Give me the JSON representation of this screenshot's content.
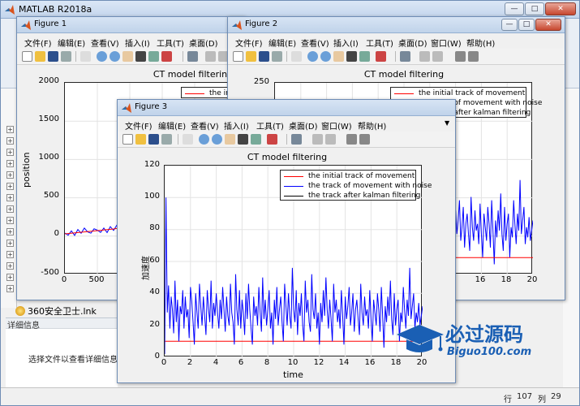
{
  "app": {
    "title": "MATLAB R2018a",
    "window_buttons": [
      "—",
      "□",
      "✕"
    ],
    "file_item": "360安全卫士.lnk",
    "details_header": "详细信息",
    "details_text": "选择文件以查看详细信息",
    "status": {
      "row_label": "行",
      "row": "107",
      "col_label": "列",
      "col": "29"
    }
  },
  "menu": [
    "文件(F)",
    "编辑(E)",
    "查看(V)",
    "插入(I)",
    "工具(T)",
    "桌面(D)",
    "窗口(W)",
    "帮助(H)"
  ],
  "figure1": {
    "title": "Figure 1",
    "plot_title": "CT model filtering",
    "ylabel": "position",
    "yticks": [
      "2000",
      "1500",
      "1000",
      "500",
      "0",
      "-500"
    ],
    "xticks": [
      "0",
      "500"
    ],
    "legend_partial": "the ini"
  },
  "figure2": {
    "title": "Figure 2",
    "plot_title": "CT model filtering",
    "yticks": [
      "250"
    ],
    "xticks": [
      "16",
      "18",
      "20"
    ],
    "legend": [
      "the initial track of movement",
      "the track of movement with noise",
      "the track after kalman filtering"
    ]
  },
  "figure3": {
    "title": "Figure 3",
    "plot_title": "CT model filtering",
    "xlabel": "time",
    "ylabel": "加速度",
    "yticks": [
      "120",
      "100",
      "80",
      "60",
      "40",
      "20",
      "0"
    ],
    "xticks": [
      "0",
      "2",
      "4",
      "6",
      "8",
      "10",
      "12",
      "14",
      "16",
      "18",
      "20"
    ],
    "legend": [
      "the initial track of movement",
      "the track of movement with noise",
      "the track after kalman filtering"
    ],
    "colors": {
      "initial": "#ff0000",
      "noise": "#0000ff",
      "kalman": "#000000"
    }
  },
  "chart_data": [
    {
      "type": "line",
      "title": "CT model filtering",
      "xlabel": "time",
      "ylabel": "加速度",
      "xlim": [
        0,
        20
      ],
      "ylim": [
        0,
        120
      ],
      "grid": true,
      "legend_position": "top-right",
      "series": [
        {
          "name": "the initial track of movement",
          "color": "#ff0000",
          "x": [
            0,
            20
          ],
          "values": [
            10,
            10
          ]
        },
        {
          "name": "the track of movement with noise",
          "color": "#0000ff",
          "x": [
            0,
            0.1,
            0.2,
            0.3,
            0.4,
            0.5,
            0.6,
            0.7,
            0.8,
            0.9,
            1.0,
            1.1,
            1.2,
            1.3,
            1.4,
            1.5,
            1.6,
            1.7,
            1.8,
            1.9,
            2.0,
            2.1,
            2.2,
            2.3,
            2.4,
            2.5,
            2.6,
            2.7,
            2.8,
            2.9,
            3.0,
            3.1,
            3.2,
            3.3,
            3.4,
            3.5,
            3.6,
            3.7,
            3.8,
            3.9,
            4.0,
            4.1,
            4.2,
            4.3,
            4.4,
            4.5,
            4.6,
            4.7,
            4.8,
            4.9,
            5.0,
            5.1,
            5.2,
            5.3,
            5.4,
            5.5,
            5.6,
            5.7,
            5.8,
            5.9,
            6.0,
            6.1,
            6.2,
            6.3,
            6.4,
            6.5,
            6.6,
            6.7,
            6.8,
            6.9,
            7.0,
            7.1,
            7.2,
            7.3,
            7.4,
            7.5,
            7.6,
            7.7,
            7.8,
            7.9,
            8.0,
            8.1,
            8.2,
            8.3,
            8.4,
            8.5,
            8.6,
            8.7,
            8.8,
            8.9,
            9.0,
            9.1,
            9.2,
            9.3,
            9.4,
            9.5,
            9.6,
            9.7,
            9.8,
            9.9,
            10.0,
            10.1,
            10.2,
            10.3,
            10.4,
            10.5,
            10.6,
            10.7,
            10.8,
            10.9,
            11.0,
            11.1,
            11.2,
            11.3,
            11.4,
            11.5,
            11.6,
            11.7,
            11.8,
            11.9,
            12.0,
            12.1,
            12.2,
            12.3,
            12.4,
            12.5,
            12.6,
            12.7,
            12.8,
            12.9,
            13.0,
            13.1,
            13.2,
            13.3,
            13.4,
            13.5,
            13.6,
            13.7,
            13.8,
            13.9,
            14.0,
            14.1,
            14.2,
            14.3,
            14.4,
            14.5,
            14.6,
            14.7,
            14.8,
            14.9,
            15.0,
            15.1,
            15.2,
            15.3,
            15.4,
            15.5,
            15.6,
            15.7,
            15.8,
            15.9,
            16.0,
            16.1,
            16.2,
            16.3,
            16.4,
            16.5,
            16.6,
            16.7,
            16.8,
            16.9,
            17.0,
            17.1,
            17.2,
            17.3,
            17.4,
            17.5,
            17.6,
            17.7,
            17.8,
            17.9,
            18.0,
            18.1,
            18.2,
            18.3,
            18.4,
            18.5,
            18.6,
            18.7,
            18.8,
            18.9,
            19.0,
            19.1,
            19.2,
            19.3,
            19.4,
            19.5,
            19.6,
            19.7,
            19.8,
            19.9,
            20.0
          ],
          "values": [
            2,
            100,
            28,
            45,
            18,
            38,
            30,
            15,
            48,
            22,
            36,
            10,
            32,
            27,
            42,
            18,
            38,
            25,
            30,
            12,
            44,
            35,
            22,
            8,
            40,
            28,
            18,
            46,
            32,
            20,
            38,
            26,
            14,
            42,
            30,
            22,
            48,
            18,
            34,
            26,
            40,
            28,
            18,
            36,
            24,
            44,
            30,
            16,
            38,
            26,
            20,
            46,
            28,
            22,
            8,
            52,
            30,
            20,
            42,
            18,
            36,
            28,
            14,
            40,
            24,
            46,
            30,
            18,
            8,
            38,
            26,
            32,
            20,
            44,
            28,
            16,
            50,
            24,
            36,
            20,
            30,
            42,
            18,
            28,
            8,
            36,
            24,
            44,
            20,
            30,
            38,
            22,
            10,
            46,
            32,
            20,
            40,
            26,
            18,
            56,
            30,
            22,
            42,
            14,
            34,
            26,
            40,
            20,
            10,
            48,
            28,
            36,
            22,
            16,
            52,
            30,
            24,
            40,
            18,
            28,
            8,
            34,
            22,
            42,
            26,
            50,
            30,
            18,
            36,
            24,
            10,
            46,
            28,
            36,
            22,
            30,
            18,
            42,
            26,
            8,
            38,
            24,
            32,
            44,
            20,
            28,
            40,
            16,
            30,
            36,
            24,
            14,
            46,
            28,
            20,
            38,
            26,
            30,
            18,
            42,
            24,
            10,
            36,
            28,
            20,
            40,
            30,
            16,
            44,
            26,
            6,
            32,
            22,
            38,
            26,
            48,
            24,
            14,
            40,
            20,
            30,
            36,
            10,
            28,
            22,
            44,
            30,
            18,
            36,
            26,
            56,
            24,
            32,
            40,
            18,
            28,
            22,
            34,
            20,
            26,
            32
          ]
        },
        {
          "name": "the track after kalman filtering",
          "color": "#000000",
          "x": [],
          "values": []
        }
      ]
    }
  ]
}
